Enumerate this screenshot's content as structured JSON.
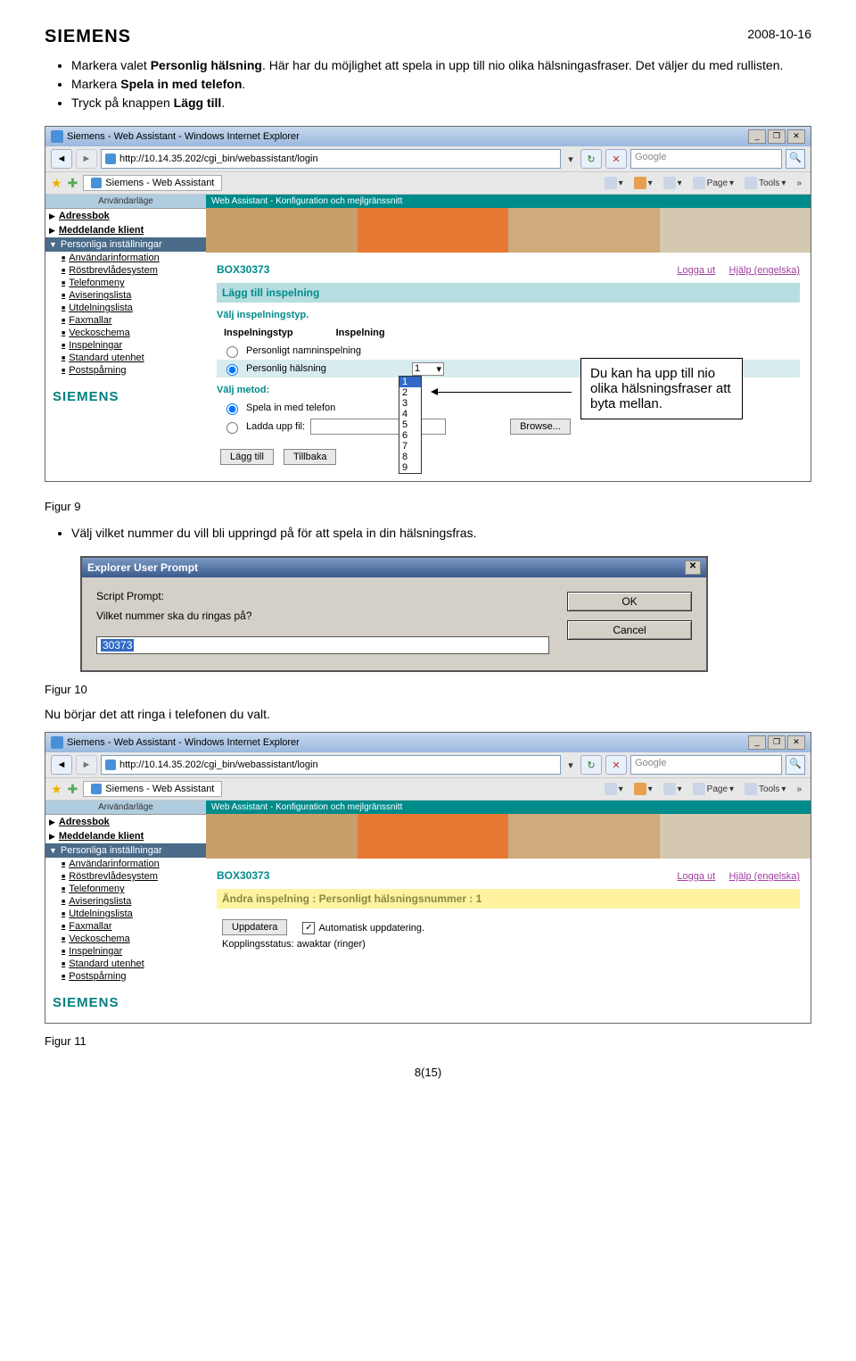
{
  "header": {
    "logo": "SIEMENS",
    "date": "2008-10-16"
  },
  "bullets_top": [
    "Markera valet Personlig hälsning. Här har du möjlighet att spela in upp till nio olika hälsningasfraser. Det väljer du med rullisten.",
    "Markera Spela in med telefon.",
    "Tryck på knappen Lägg till."
  ],
  "ie": {
    "title": "Siemens - Web Assistant - Windows Internet Explorer",
    "url": "http://10.14.35.202/cgi_bin/webassistant/login",
    "search_placeholder": "Google",
    "tab": "Siemens - Web Assistant",
    "tool_page": "Page",
    "tool_tools": "Tools",
    "nav_refresh": "↻",
    "nav_stop": "✕"
  },
  "sidebar": {
    "mode": "Användarläge",
    "s1": "Adressbok",
    "s2": "Meddelande klient",
    "s3": "Personliga inställningar",
    "items": [
      "Användarinformation",
      "Röstbrevlådesystem",
      "Telefonmeny",
      "Aviseringslista",
      "Utdelningslista",
      "Faxmallar",
      "Veckoschema",
      "Inspelningar",
      "Standard utenhet",
      "Postspårning"
    ],
    "logo": "SIEMENS"
  },
  "main1": {
    "header": "Web Assistant - Konfiguration och mejlgränssnitt",
    "boxid": "BOX30373",
    "logout": "Logga ut",
    "help": "Hjälp (engelska)",
    "title": "Lägg till inspelning",
    "sub1": "Välj inspelningstyp.",
    "col1": "Inspelningstyp",
    "col2": "Inspelning",
    "opt1": "Personligt namninspelning",
    "opt2": "Personlig hälsning",
    "sel_val": "1",
    "dd": [
      "1",
      "2",
      "3",
      "4",
      "5",
      "6",
      "7",
      "8",
      "9"
    ],
    "sub2": "Välj metod:",
    "m1": "Spela in med telefon",
    "m2": "Ladda upp fil:",
    "browse": "Browse...",
    "btn1": "Lägg till",
    "btn2": "Tillbaka"
  },
  "note": "Du kan ha upp till nio olika hälsningsfraser att byta mellan.",
  "fig9": "Figur 9",
  "bullets_mid": [
    "Välj vilket nummer du vill bli uppringd på för att spela in din hälsningsfras."
  ],
  "dialog": {
    "title": "Explorer User Prompt",
    "line1": "Script Prompt:",
    "line2": "Vilket nummer ska du ringas på?",
    "ok": "OK",
    "cancel": "Cancel",
    "value": "30373"
  },
  "fig10": "Figur 10",
  "text_mid": "Nu börjar det att ringa i telefonen du valt.",
  "main2": {
    "title": "Ändra inspelning : Personligt hälsningsnummer : 1",
    "btn": "Uppdatera",
    "chk_label": "Automatisk uppdatering.",
    "status": "Kopplingsstatus: awaktar (ringer)"
  },
  "fig11": "Figur 11",
  "pagenum": "8(15)"
}
